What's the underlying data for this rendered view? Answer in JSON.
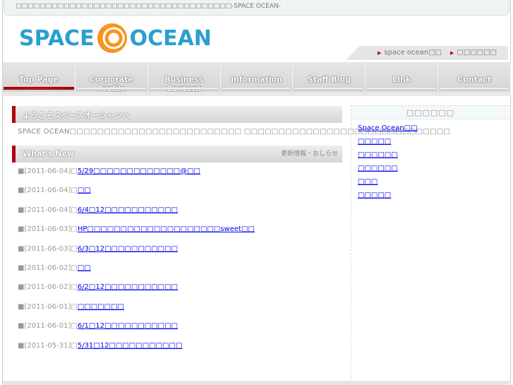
{
  "top_tagline": "□□□□□□□□□□□□□□□□□□□□□□□□□□□□□□□□□□□□-SPACE OCEAN-",
  "logo": {
    "left": "SPACE",
    "right": "OCEAN"
  },
  "sublinks": [
    "space ocean□□",
    "□□□□□□"
  ],
  "nav": [
    "Top Page",
    "Corporate Profile",
    "Business Content",
    "Information",
    "Staff Blog",
    "Link",
    "Contact"
  ],
  "welcome": {
    "heading": "ようこそスペースオーシャンへ",
    "text": "SPACE OCEAN□□□□□□□□□□□□□□□□□□□□□□□□□ □□□□□□□□□□□□□□□□□□□□□□□□□□□□□□"
  },
  "whats_new": {
    "heading": "What's New",
    "subtitle": "更新情報・おしらせ",
    "items": [
      {
        "date": "■[2011-06-04]□",
        "title": "5/29□□□□□□□□□□□□□@□□"
      },
      {
        "date": "■[2011-06-04]□",
        "title": "□□"
      },
      {
        "date": "■[2011-06-04]□",
        "title": "6/4□12□□□□□□□□□□□"
      },
      {
        "date": "■[2011-06-03]□",
        "title": "HP□□□□□□□□□□□□□□□□□□□□sweet□□"
      },
      {
        "date": "■[2011-06-03]□",
        "title": "6/3□12□□□□□□□□□□□"
      },
      {
        "date": "■[2011-06-02]□",
        "title": "□□"
      },
      {
        "date": "■[2011-06-02]□",
        "title": "6/2□12□□□□□□□□□□□"
      },
      {
        "date": "■[2011-06-01]□",
        "title": "□□□□□□□"
      },
      {
        "date": "■[2011-06-01]□",
        "title": "6/1□12□□□□□□□□□□□"
      },
      {
        "date": "■[2011-05-31]□",
        "title": "5/31□12□□□□□□□□□□□"
      }
    ]
  },
  "sidebar": {
    "title": "□□□□□□",
    "links": [
      "Space Ocean□□",
      "□□□□□",
      "□□□□□□",
      "□□□□□□",
      "□□□",
      "□□□□□"
    ]
  }
}
